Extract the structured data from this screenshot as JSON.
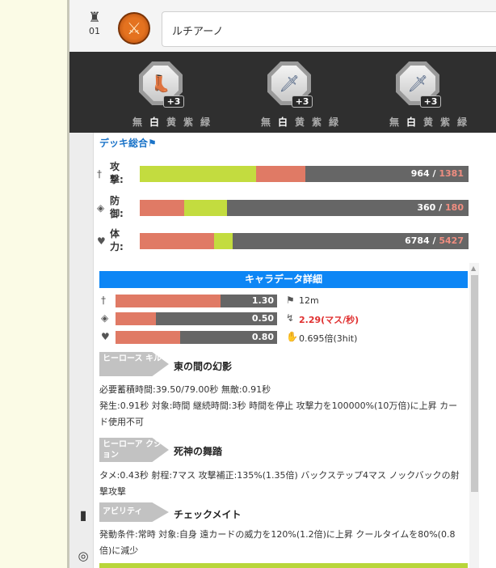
{
  "header": {
    "char_number": "01",
    "char_name": "ルチアーノ"
  },
  "equipment": [
    {
      "icon": "boots-icon",
      "level": "+3",
      "colors": [
        "無",
        "白",
        "黄",
        "紫",
        "緑"
      ]
    },
    {
      "icon": "sword-icon",
      "level": "+3",
      "colors": [
        "無",
        "白",
        "黄",
        "紫",
        "緑"
      ]
    },
    {
      "icon": "sword-icon",
      "level": "+3",
      "colors": [
        "無",
        "白",
        "黄",
        "紫",
        "緑"
      ]
    }
  ],
  "deck": {
    "title": "デッキ総合",
    "stats": [
      {
        "label": "攻撃:",
        "value": "964",
        "sep": " / ",
        "alt": "1381",
        "green_pct": 35.4,
        "red_pct": 15.0
      },
      {
        "label": "防御:",
        "value": "360",
        "sep": " / ",
        "alt": "180",
        "red_pct": 13.5,
        "green_pct": 13.0
      },
      {
        "label": "体力:",
        "value": "6784",
        "sep": " / ",
        "alt": "5427",
        "red_pct": 22.7,
        "green_pct": 5.5
      }
    ]
  },
  "detail": {
    "title": "キャラデータ詳細",
    "rows": [
      {
        "value": "1.30",
        "pct": 65,
        "right_text": "12m"
      },
      {
        "value": "0.50",
        "pct": 25,
        "right_text": "2.29(マス/秒)"
      },
      {
        "value": "0.80",
        "pct": 40,
        "right_text": "0.695倍(3hit)"
      }
    ],
    "skills": [
      {
        "tag": "ヒーロース キル",
        "name": "東の間の幻影",
        "desc": "必要蓄積時間:39.50/79.00秒 無敵:0.91秒\n発生:0.91秒 対象:時間 継続時間:3秒 時間を停止 攻撃力を100000%(10万倍)に上昇 カード使用不可"
      },
      {
        "tag": "ヒーローア クション",
        "name": "死神の舞踏",
        "desc": "タメ:0.43秒 射程:7マス 攻撃補正:135%(1.35倍) バックステップ4マス ノックバックの射撃攻撃"
      },
      {
        "tag": "アビリティ",
        "name": "チェックメイト",
        "desc": "発動条件:常時 対象:自身 遠カードの威力を120%(1.2倍)に上昇 クールタイムを80%(0.8倍)に減少"
      }
    ]
  },
  "colors": {
    "green": "#c3dc3f",
    "red": "#e07a65",
    "blue": "#0d86f5",
    "dark": "#2f2f2f"
  }
}
